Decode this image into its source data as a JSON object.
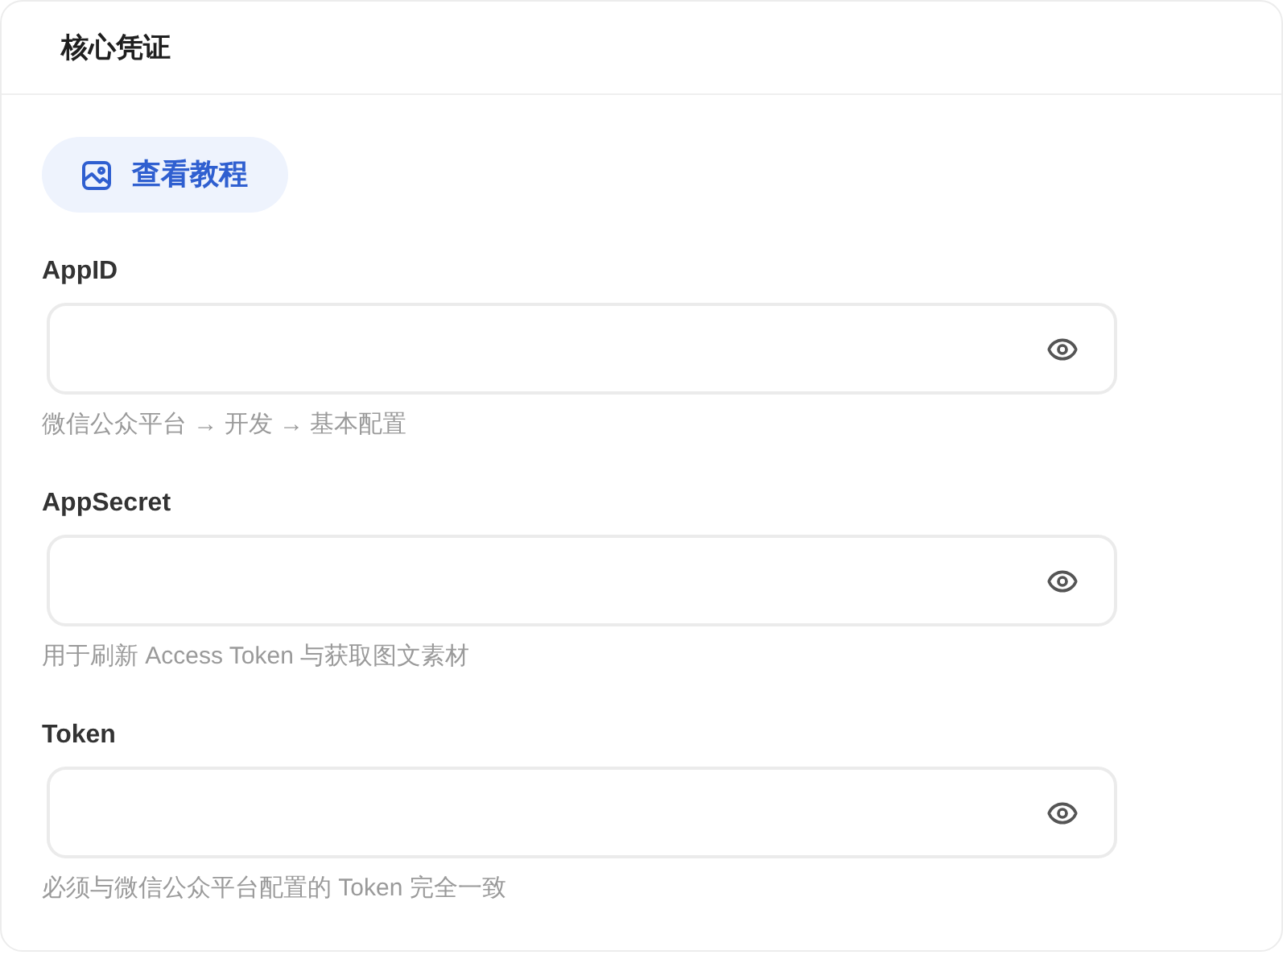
{
  "card": {
    "title": "核心凭证"
  },
  "tutorial_button": {
    "label": "查看教程"
  },
  "fields": [
    {
      "label": "AppID",
      "hint": "微信公众平台 → 开发 → 基本配置"
    },
    {
      "label": "AppSecret",
      "hint": "用于刷新 Access Token 与获取图文素材"
    },
    {
      "label": "Token",
      "hint": "必须与微信公众平台配置的 Token 完全一致"
    }
  ]
}
